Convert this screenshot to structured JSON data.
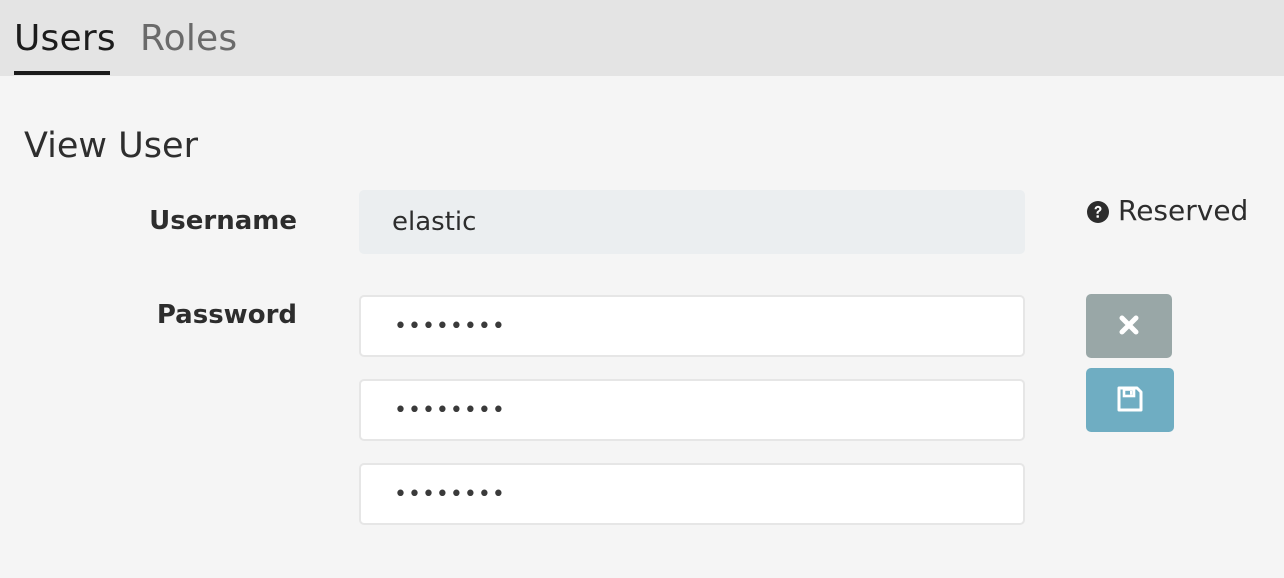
{
  "tabs": {
    "users_label": "Users",
    "roles_label": "Roles",
    "active": "Users"
  },
  "page": {
    "title": "View User"
  },
  "form": {
    "username_label": "Username",
    "username_value": "elastic",
    "password_label": "Password",
    "password_value": "••••••••",
    "password_confirm_value": "••••••••",
    "password_third_value": "••••••••",
    "reserved_label": "Reserved"
  },
  "icons": {
    "reserved": "question-circle-icon",
    "cancel": "close-icon",
    "save": "save-icon"
  },
  "colors": {
    "tab_bar_bg": "#e4e4e4",
    "page_bg": "#f5f5f5",
    "cancel_button_bg": "#99a7a7",
    "save_button_bg": "#6fadc2",
    "readonly_field_bg": "#ebeef0"
  }
}
